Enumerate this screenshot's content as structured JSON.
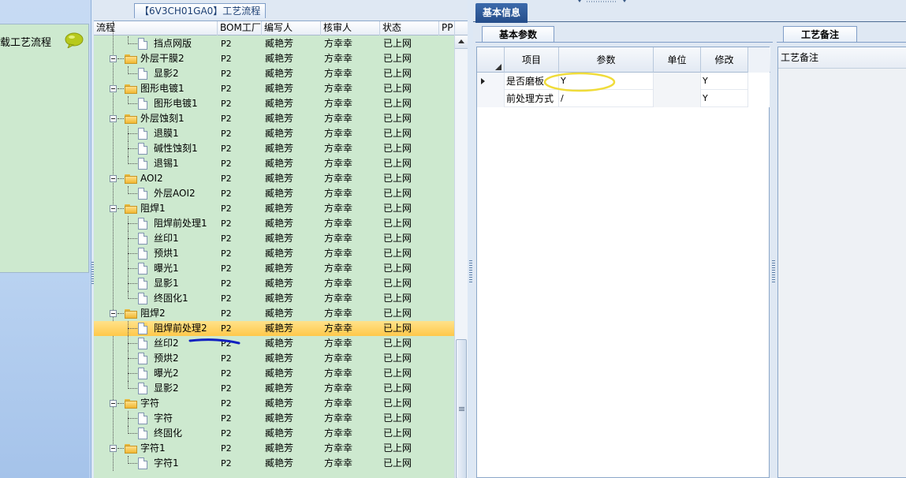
{
  "left_panel": {
    "load_label": "载工艺流程"
  },
  "tree_panel": {
    "title": "【6V3CH01GA0】工艺流程",
    "columns": [
      "流程",
      "BOM工厂",
      "编写人",
      "核审人",
      "状态",
      "PP"
    ],
    "rows": [
      {
        "depth": 1,
        "type": "doc",
        "name": "挡点网版",
        "bom": "P2",
        "writer": "臧艳芳",
        "reviewer": "方幸幸",
        "status": "已上网"
      },
      {
        "depth": 0,
        "type": "folder",
        "name": "外层干膜2",
        "bom": "P2",
        "writer": "臧艳芳",
        "reviewer": "方幸幸",
        "status": "已上网"
      },
      {
        "depth": 1,
        "type": "doc",
        "name": "显影2",
        "bom": "P2",
        "writer": "臧艳芳",
        "reviewer": "方幸幸",
        "status": "已上网"
      },
      {
        "depth": 0,
        "type": "folder",
        "name": "图形电镀1",
        "bom": "P2",
        "writer": "臧艳芳",
        "reviewer": "方幸幸",
        "status": "已上网"
      },
      {
        "depth": 1,
        "type": "doc",
        "name": "图形电镀1",
        "bom": "P2",
        "writer": "臧艳芳",
        "reviewer": "方幸幸",
        "status": "已上网"
      },
      {
        "depth": 0,
        "type": "folder",
        "name": "外层蚀刻1",
        "bom": "P2",
        "writer": "臧艳芳",
        "reviewer": "方幸幸",
        "status": "已上网"
      },
      {
        "depth": 1,
        "type": "doc",
        "name": "退膜1",
        "bom": "P2",
        "writer": "臧艳芳",
        "reviewer": "方幸幸",
        "status": "已上网"
      },
      {
        "depth": 1,
        "type": "doc",
        "name": "碱性蚀刻1",
        "bom": "P2",
        "writer": "臧艳芳",
        "reviewer": "方幸幸",
        "status": "已上网"
      },
      {
        "depth": 1,
        "type": "doc",
        "name": "退锡1",
        "bom": "P2",
        "writer": "臧艳芳",
        "reviewer": "方幸幸",
        "status": "已上网"
      },
      {
        "depth": 0,
        "type": "folder",
        "name": "AOI2",
        "bom": "P2",
        "writer": "臧艳芳",
        "reviewer": "方幸幸",
        "status": "已上网"
      },
      {
        "depth": 1,
        "type": "doc",
        "name": "外层AOI2",
        "bom": "P2",
        "writer": "臧艳芳",
        "reviewer": "方幸幸",
        "status": "已上网"
      },
      {
        "depth": 0,
        "type": "folder",
        "name": "阻焊1",
        "bom": "P2",
        "writer": "臧艳芳",
        "reviewer": "方幸幸",
        "status": "已上网"
      },
      {
        "depth": 1,
        "type": "doc",
        "name": "阻焊前处理1",
        "bom": "P2",
        "writer": "臧艳芳",
        "reviewer": "方幸幸",
        "status": "已上网"
      },
      {
        "depth": 1,
        "type": "doc",
        "name": "丝印1",
        "bom": "P2",
        "writer": "臧艳芳",
        "reviewer": "方幸幸",
        "status": "已上网"
      },
      {
        "depth": 1,
        "type": "doc",
        "name": "预烘1",
        "bom": "P2",
        "writer": "臧艳芳",
        "reviewer": "方幸幸",
        "status": "已上网"
      },
      {
        "depth": 1,
        "type": "doc",
        "name": "曝光1",
        "bom": "P2",
        "writer": "臧艳芳",
        "reviewer": "方幸幸",
        "status": "已上网"
      },
      {
        "depth": 1,
        "type": "doc",
        "name": "显影1",
        "bom": "P2",
        "writer": "臧艳芳",
        "reviewer": "方幸幸",
        "status": "已上网"
      },
      {
        "depth": 1,
        "type": "doc",
        "name": "终固化1",
        "bom": "P2",
        "writer": "臧艳芳",
        "reviewer": "方幸幸",
        "status": "已上网"
      },
      {
        "depth": 0,
        "type": "folder",
        "name": "阻焊2",
        "bom": "P2",
        "writer": "臧艳芳",
        "reviewer": "方幸幸",
        "status": "已上网"
      },
      {
        "depth": 1,
        "type": "doc",
        "name": "阻焊前处理2",
        "bom": "P2",
        "writer": "臧艳芳",
        "reviewer": "方幸幸",
        "status": "已上网",
        "selected": true
      },
      {
        "depth": 1,
        "type": "doc",
        "name": "丝印2",
        "bom": "P2",
        "writer": "臧艳芳",
        "reviewer": "方幸幸",
        "status": "已上网"
      },
      {
        "depth": 1,
        "type": "doc",
        "name": "预烘2",
        "bom": "P2",
        "writer": "臧艳芳",
        "reviewer": "方幸幸",
        "status": "已上网"
      },
      {
        "depth": 1,
        "type": "doc",
        "name": "曝光2",
        "bom": "P2",
        "writer": "臧艳芳",
        "reviewer": "方幸幸",
        "status": "已上网"
      },
      {
        "depth": 1,
        "type": "doc",
        "name": "显影2",
        "bom": "P2",
        "writer": "臧艳芳",
        "reviewer": "方幸幸",
        "status": "已上网"
      },
      {
        "depth": 0,
        "type": "folder",
        "name": "字符",
        "bom": "P2",
        "writer": "臧艳芳",
        "reviewer": "方幸幸",
        "status": "已上网"
      },
      {
        "depth": 1,
        "type": "doc",
        "name": "字符",
        "bom": "P2",
        "writer": "臧艳芳",
        "reviewer": "方幸幸",
        "status": "已上网"
      },
      {
        "depth": 1,
        "type": "doc",
        "name": "终固化",
        "bom": "P2",
        "writer": "臧艳芳",
        "reviewer": "方幸幸",
        "status": "已上网"
      },
      {
        "depth": 0,
        "type": "folder",
        "name": "字符1",
        "bom": "P2",
        "writer": "臧艳芳",
        "reviewer": "方幸幸",
        "status": "已上网"
      },
      {
        "depth": 1,
        "type": "doc",
        "name": "字符1",
        "bom": "P2",
        "writer": "臧艳芳",
        "reviewer": "方幸幸",
        "status": "已上网"
      }
    ]
  },
  "info_panel": {
    "tab_label": "基本信息",
    "sub_tab_label": "基本参数",
    "columns": [
      "项目",
      "参数",
      "单位",
      "修改"
    ],
    "rows": [
      {
        "item": "是否磨板",
        "param": "Y",
        "unit": "",
        "modify": "Y",
        "current": true
      },
      {
        "item": "前处理方式",
        "param": "/",
        "unit": "",
        "modify": "Y",
        "current": false
      }
    ]
  },
  "notes_panel": {
    "tab_label": "工艺备注",
    "header": "工艺备注"
  },
  "colors": {
    "tree_bg": "#cde9cf",
    "selected_row": "#ffc84a",
    "tab_active": "#254d8a",
    "annotation_ellipse": "#f0dc3a",
    "annotation_underline": "#1020c0"
  }
}
